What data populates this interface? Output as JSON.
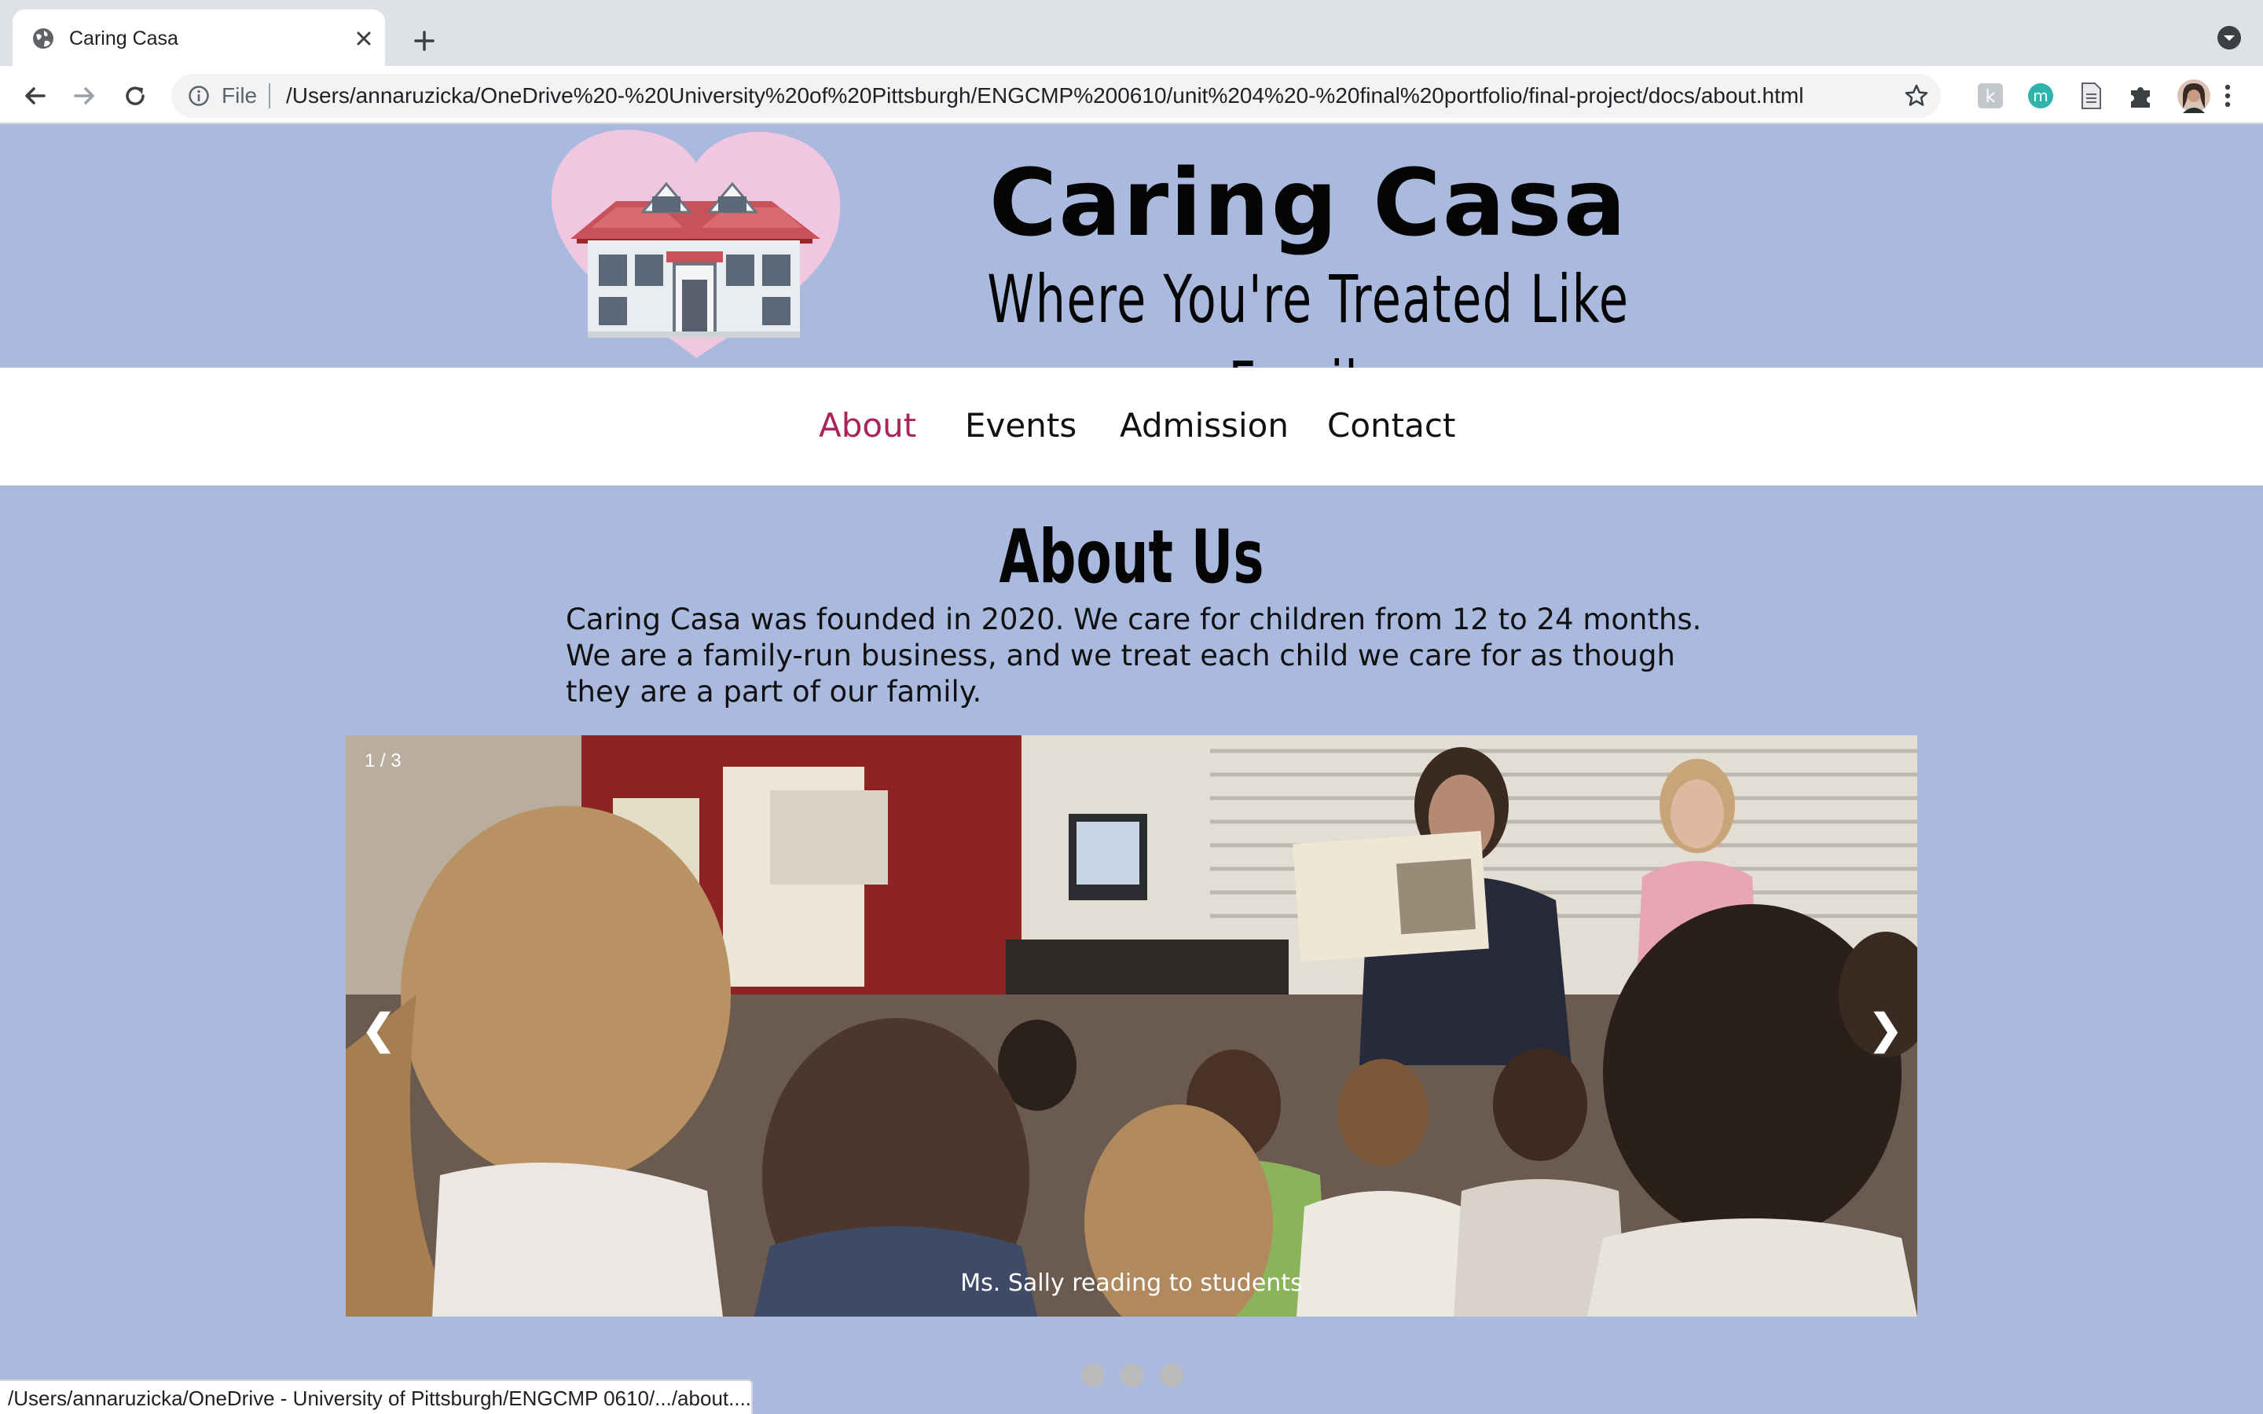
{
  "browser": {
    "tab_title": "Caring Casa",
    "scheme_label": "File",
    "url": "/Users/annaruzicka/OneDrive%20-%20University%20of%20Pittsburgh/ENGCMP%200610/unit%204%20-%20final%20portfolio/final-project/docs/about.html",
    "status_url": "/Users/annaruzicka/OneDrive - University of Pittsburgh/ENGCMP 0610/.../about....",
    "extensions": [
      "k-extension-icon",
      "m-extension-icon",
      "document-extension-icon",
      "puzzle-icon"
    ]
  },
  "site": {
    "title": "Caring Casa",
    "tagline": "Where You're Treated Like Family"
  },
  "nav": {
    "items": [
      {
        "label": "About",
        "active": true
      },
      {
        "label": "Events",
        "active": false
      },
      {
        "label": "Admission",
        "active": false
      },
      {
        "label": "Contact",
        "active": false
      }
    ]
  },
  "about": {
    "heading": "About Us",
    "body": "Caring Casa was founded in 2020. We care for children from 12 to 24 months. We are a family-run business, and we treat each child we care for as though they are a part of our family."
  },
  "slideshow": {
    "counter": "1 / 3",
    "caption": "Ms. Sally reading to students",
    "prev_glyph": "❮",
    "next_glyph": "❯",
    "total_slides": 3,
    "current_slide": 1
  },
  "colors": {
    "page_bg": "#aab9de",
    "nav_active": "#a8265a",
    "logo_heart": "#f0c6e0"
  }
}
